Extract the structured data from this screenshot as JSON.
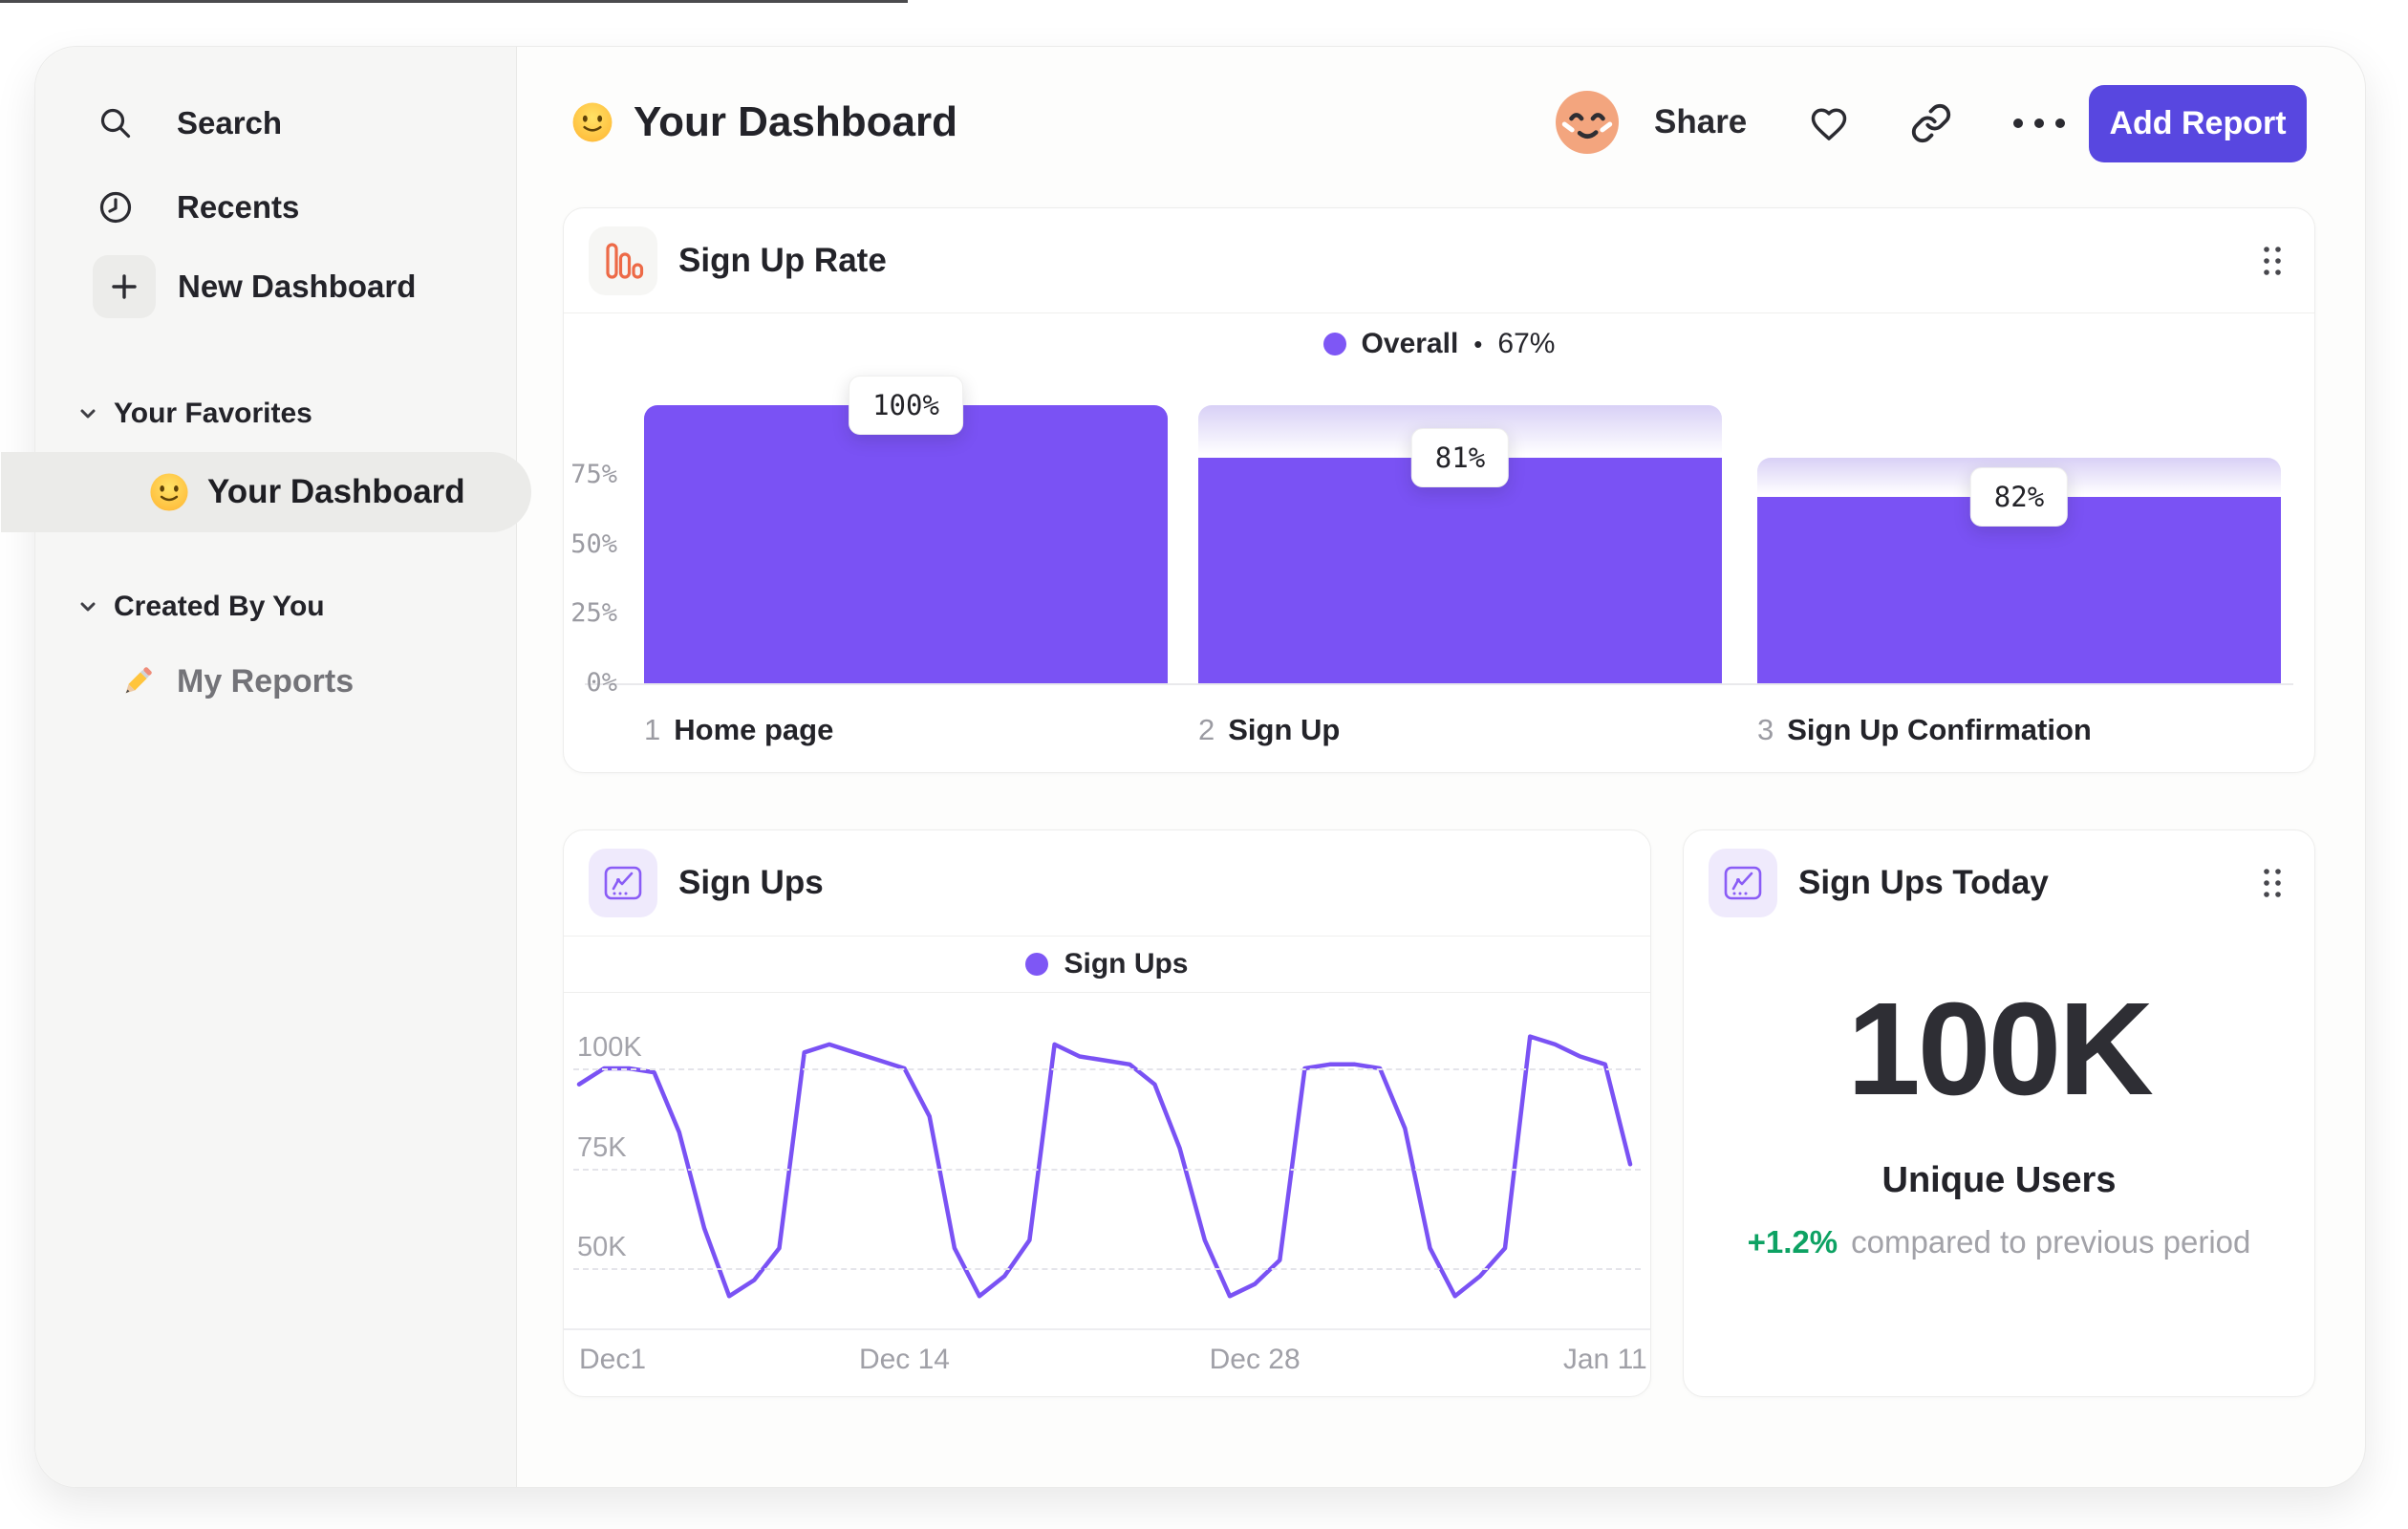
{
  "colors": {
    "accent_button": "#5847e0",
    "series_purple": "#7a52f4",
    "legend_dot": "#7e57f5",
    "ghost_top": "#d8d0f6",
    "orange_icon": "#ed6a47",
    "purple_icon": "#8a5cf6",
    "green": "#0da263",
    "sidebar_bg": "#f6f6f5"
  },
  "sidebar": {
    "items": [
      {
        "icon": "search-icon",
        "label": "Search"
      },
      {
        "icon": "clock-icon",
        "label": "Recents"
      },
      {
        "icon": "plus-icon",
        "label": "New Dashboard"
      }
    ],
    "sections": [
      {
        "label": "Your Favorites",
        "items": [
          {
            "icon": "smiley-icon",
            "label": "Your Dashboard",
            "active": true
          }
        ]
      },
      {
        "label": "Created By You",
        "items": [
          {
            "icon": "pencil-icon",
            "label": "My Reports",
            "active": false
          }
        ]
      }
    ]
  },
  "header": {
    "title": "Your Dashboard",
    "title_emoji": "slightly-smiling-face",
    "share_label": "Share",
    "add_report_label": "Add Report"
  },
  "cards": {
    "funnel": {
      "title": "Sign Up Rate",
      "legend_label": "Overall",
      "legend_separator": "•",
      "legend_value": "67%"
    },
    "line": {
      "title": "Sign Ups",
      "legend_label": "Sign Ups"
    },
    "today": {
      "title": "Sign Ups Today",
      "value": "100K",
      "value_label": "Unique Users",
      "delta": "+1.2%",
      "delta_caption": "compared to previous period"
    }
  },
  "chart_data": [
    {
      "type": "bar",
      "subtype": "funnel",
      "title": "Sign Up Rate",
      "legend": "Overall • 67%",
      "overall": "67%",
      "categories": [
        "Home page",
        "Sign Up",
        "Sign Up Confirmation"
      ],
      "step_numbers": [
        "1",
        "2",
        "3"
      ],
      "step_conversion_labels": [
        "100%",
        "81%",
        "82%"
      ],
      "values_pct_of_previous": [
        100,
        81,
        82
      ],
      "values_pct_of_total": [
        100,
        81,
        67
      ],
      "yticks": [
        {
          "label": "75%",
          "value": 75
        },
        {
          "label": "50%",
          "value": 50
        },
        {
          "label": "25%",
          "value": 25
        },
        {
          "label": "0%",
          "value": 0
        }
      ],
      "ylim": [
        0,
        100
      ],
      "legend_position": "top-center"
    },
    {
      "type": "line",
      "title": "Sign Ups",
      "legend": "Sign Ups",
      "unit": "K",
      "x_ticks": [
        {
          "label": "Dec1",
          "day": 0,
          "align": "left"
        },
        {
          "label": "Dec 14",
          "day": 13,
          "align": "center"
        },
        {
          "label": "Dec 28",
          "day": 27,
          "align": "center"
        },
        {
          "label": "Jan 11",
          "day": 41,
          "align": "center"
        }
      ],
      "y_ticks": [
        {
          "label": "100K",
          "value": 100
        },
        {
          "label": "75K",
          "value": 75
        },
        {
          "label": "50K",
          "value": 50
        }
      ],
      "values_thousands": [
        96,
        100,
        100,
        99,
        84,
        60,
        43,
        47,
        55,
        104,
        106,
        104,
        102,
        100,
        88,
        55,
        43,
        48,
        57,
        106,
        103,
        102,
        101,
        96,
        80,
        57,
        43,
        46,
        52,
        100,
        101,
        101,
        100,
        85,
        55,
        43,
        48,
        55,
        108,
        106,
        103,
        101,
        76
      ],
      "ylim": [
        30,
        115
      ],
      "grid": "dashed-horizontal"
    }
  ]
}
